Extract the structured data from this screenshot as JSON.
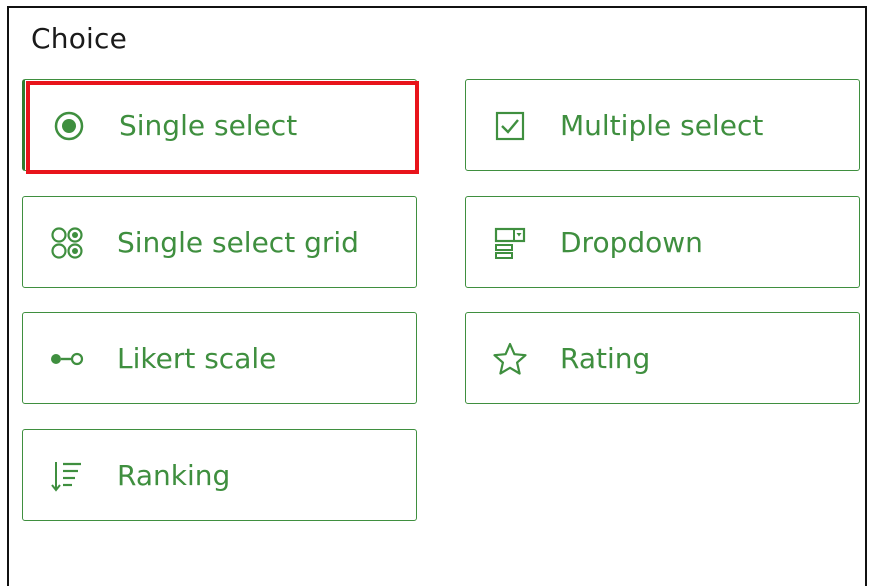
{
  "section": {
    "title": "Choice"
  },
  "options": [
    {
      "label": "Single select",
      "icon": "radio-button-icon",
      "selected": true
    },
    {
      "label": "Multiple select",
      "icon": "checkbox-icon",
      "selected": false
    },
    {
      "label": "Single select grid",
      "icon": "radio-grid-icon",
      "selected": false
    },
    {
      "label": "Dropdown",
      "icon": "dropdown-icon",
      "selected": false
    },
    {
      "label": "Likert scale",
      "icon": "likert-scale-icon",
      "selected": false
    },
    {
      "label": "Rating",
      "icon": "star-icon",
      "selected": false
    },
    {
      "label": "Ranking",
      "icon": "ranking-icon",
      "selected": false
    }
  ],
  "colors": {
    "accent": "#3f8f3f",
    "highlight": "#e8141b",
    "title": "#1a1a1a"
  }
}
